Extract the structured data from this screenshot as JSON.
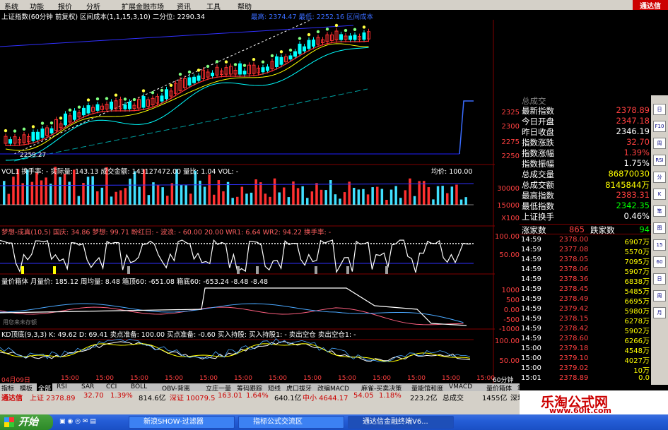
{
  "menu": {
    "items": [
      "系统",
      "功能",
      "报价",
      "分析",
      "扩展金融市场",
      "资讯",
      "工具",
      "帮助"
    ],
    "brand": "通达信"
  },
  "main_chart": {
    "title": "上证指数(60分钟 前复权) 区间成本(1,1,15,3,10) 二分位: 2290.34",
    "legend_right": "最高: 2374.47 最低: 2252.16 区间成本",
    "axis": [
      "2325",
      "2300",
      "2275",
      "2250"
    ],
    "low_label": "2259.27",
    "colors": {
      "up": "#ff3030",
      "down": "#00ffff",
      "avg": "#ffff00"
    }
  },
  "vol_panel": {
    "title": "VOL1 换手率: - 实际量: 143.13 成交金额: 143127472.00 量比: 1.04 VOL: -",
    "title_right": "均价: 100.00",
    "axis": [
      "30000",
      "15000",
      "X100"
    ]
  },
  "dream_panel": {
    "title": "梦想-成真(10,5) 国庆: 34.86 梦想: 99.71 盼红日: - 波浪: - 60.00 20.00 WR1: 6.64 WR2: 94.22 换手率: -",
    "axis": [
      "100.00",
      "50.00"
    ]
  },
  "box_panel": {
    "title": "量价箱体 月量价: 185.12 周均量: 8.48 箱顶60: -651.08 箱底60: -653.24 -8.48 -8.48",
    "axis": [
      "1000",
      "500",
      "0.00",
      "-500",
      "-1000"
    ],
    "subtitle": "用您来未存额"
  },
  "kd_panel": {
    "title": "KD顶底(9,3,3) K: 49.62 D: 69.41 卖点准备: 100.00 买点准备: -0.60 买入持股: 买入持股1: - 卖出空仓 卖出空仓1: -",
    "axis": [
      "100.00",
      "50.00"
    ]
  },
  "quote": {
    "header": "总成交",
    "rows": [
      {
        "label": "最新指数",
        "value": "2378.89",
        "color": "#ff4040"
      },
      {
        "label": "今日开盘",
        "value": "2347.18",
        "color": "#ff4040"
      },
      {
        "label": "昨日收盘",
        "value": "2346.19",
        "color": "#ffffff"
      },
      {
        "label": "指数涨跌",
        "value": "32.70",
        "color": "#ff4040"
      },
      {
        "label": "指数涨幅",
        "value": "1.39%",
        "color": "#ff4040"
      },
      {
        "label": "指数振幅",
        "value": "1.75%",
        "color": "#ffffff"
      },
      {
        "label": "总成交量",
        "value": "86870030",
        "color": "#ffff00"
      },
      {
        "label": "总成交额",
        "value": "8145844万",
        "color": "#ffff00"
      },
      {
        "label": "最高指数",
        "value": "2383.31",
        "color": "#ff4040"
      },
      {
        "label": "最低指数",
        "value": "2342.35",
        "color": "#00ff00"
      },
      {
        "label": "上证换手",
        "value": "0.46%",
        "color": "#ffffff"
      }
    ],
    "updown": {
      "up_label": "涨家数",
      "up": "865",
      "down_label": "跌家数",
      "down": "94"
    }
  },
  "ticks": [
    {
      "t": "14:59",
      "p": "2378.00",
      "v": "6907万"
    },
    {
      "t": "14:59",
      "p": "2377.08",
      "v": "5570万"
    },
    {
      "t": "14:59",
      "p": "2378.05",
      "v": "7095万"
    },
    {
      "t": "14:59",
      "p": "2378.06",
      "v": "5907万"
    },
    {
      "t": "14:59",
      "p": "2378.36",
      "v": "6838万"
    },
    {
      "t": "14:59",
      "p": "2378.45",
      "v": "5485万"
    },
    {
      "t": "14:59",
      "p": "2378.49",
      "v": "6695万"
    },
    {
      "t": "14:59",
      "p": "2379.42",
      "v": "5980万"
    },
    {
      "t": "14:59",
      "p": "2378.15",
      "v": "6278万"
    },
    {
      "t": "14:59",
      "p": "2378.42",
      "v": "5902万"
    },
    {
      "t": "14:59",
      "p": "2378.60",
      "v": "6266万"
    },
    {
      "t": "15:00",
      "p": "2379.18",
      "v": "4548万"
    },
    {
      "t": "15:00",
      "p": "2379.10",
      "v": "4027万"
    },
    {
      "t": "15:00",
      "p": "2379.02",
      "v": "10万"
    },
    {
      "t": "15:01",
      "p": "2378.89",
      "v": "0.0"
    }
  ],
  "time_axis": {
    "date": "04月09日",
    "labels": [
      "15:00",
      "15:00",
      "15:00",
      "15:00",
      "15:00",
      "15:00",
      "15:00",
      "15:00",
      "15:00",
      "15:00",
      "15:00",
      "15:00",
      "15:00"
    ],
    "period": "60分钟"
  },
  "tabs": [
    "指标",
    "模板",
    "全部",
    "RSI",
    "SAR",
    "CCI",
    "BOLL",
    "OBV-背离",
    "立庄一量",
    "筹码跟踪",
    "短线",
    "虎口拔牙",
    "改编MACD",
    "麻雀-买卖决策",
    "量能馆和度",
    "VMACD",
    "量价箱体",
    "笔"
  ],
  "sidebar_buttons": [
    "日",
    "F10",
    "周",
    "RSI",
    "分",
    "K",
    "笔",
    "图",
    "15",
    "60",
    "日",
    "周",
    "月"
  ],
  "status": {
    "name": "通达信",
    "index": "上证 2378.89",
    "chg": "32.70",
    "pct": "1.39%",
    "amt": "814.6亿",
    "sz": "深证 10079.5",
    "sz_chg": "163.01",
    "sz_pct": "1.64%",
    "sz_amt": "640.1亿",
    "zx": "中小 4644.17",
    "zx_chg": "54.05",
    "zx_pct": "1.18%",
    "zx_amt": "223.2亿",
    "total": "总成交",
    "total_v": "1455亿",
    "right": "深圳联"
  },
  "taskbar": {
    "start": "开始",
    "items": [
      "新浪SHOW-过滤器",
      "指标公式交流区",
      "通达信金融终端V6..."
    ]
  },
  "watermark": {
    "title": "乐淘公式网",
    "url": "www.60lt.com"
  }
}
